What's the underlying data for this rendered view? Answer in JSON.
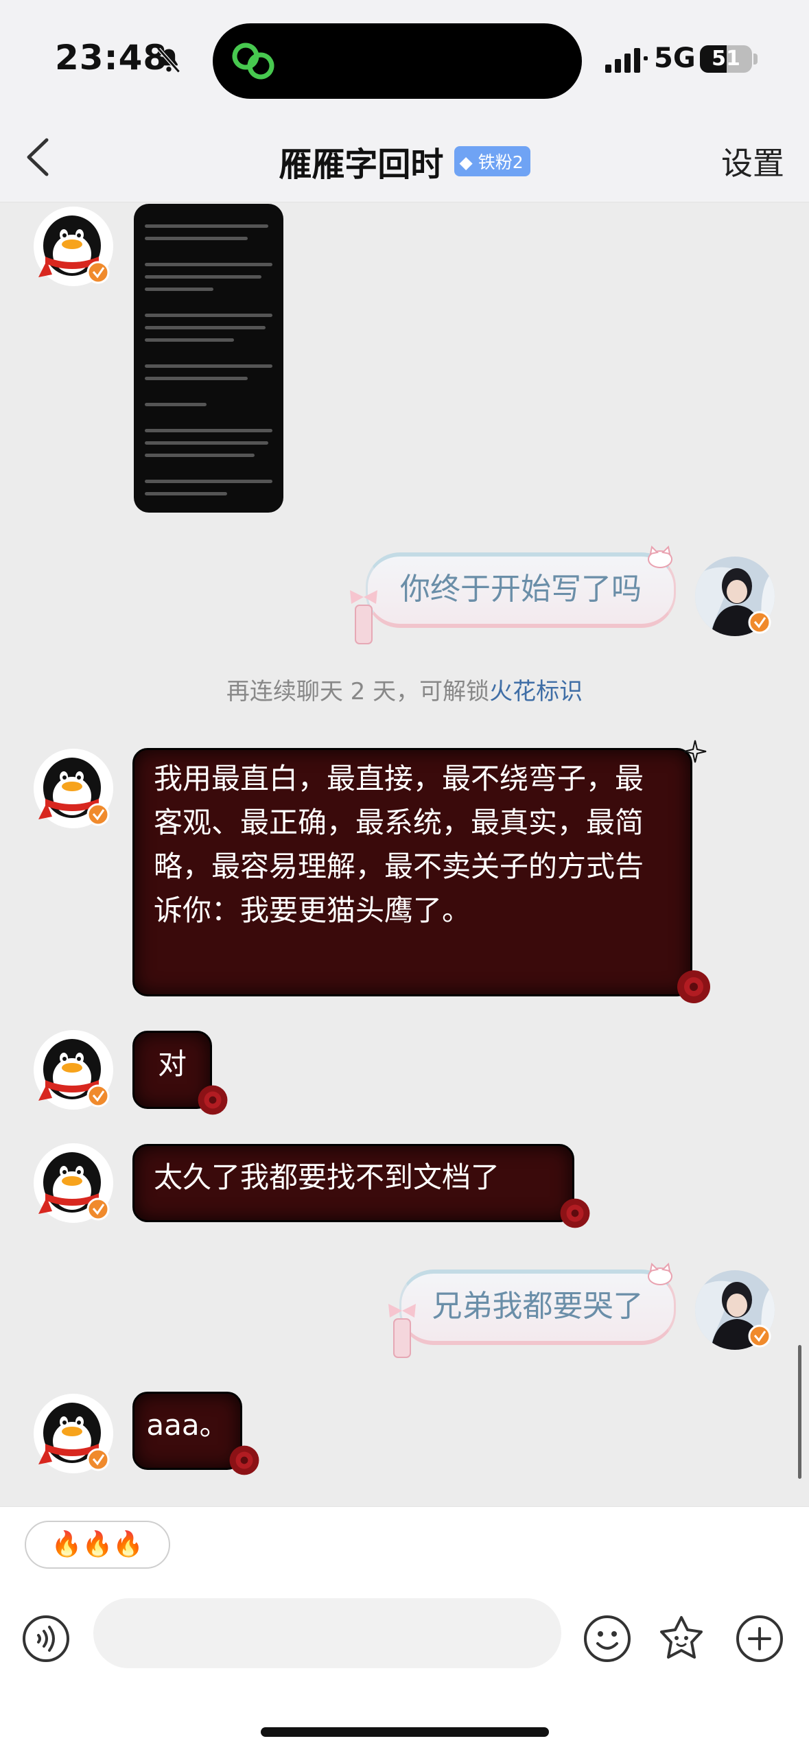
{
  "status_bar": {
    "time": "23:48",
    "network": "5G",
    "battery": "51",
    "battery_level": 0.51,
    "icons": [
      "bell-slash-icon",
      "app-link-icon",
      "signal-icon"
    ]
  },
  "header": {
    "back_icon": "chevron-left-icon",
    "title": "雁雁字回时",
    "badge": "铁粉2",
    "badge_icon": "diamond-icon",
    "settings": "设置"
  },
  "messages": [
    {
      "side": "left",
      "type": "image"
    },
    {
      "side": "right",
      "text": "你终于开始写了吗"
    },
    {
      "side": "system",
      "text": "再连续聊天 2 天，可解锁",
      "link": "火花标识"
    },
    {
      "side": "left",
      "text": "我用最直白，最直接，最不绕弯子，最客观、最正确，最系统，最真实，最简略，最容易理解，最不卖关子的方式告诉你：我要更猫头鹰了。"
    },
    {
      "side": "left",
      "text": "对"
    },
    {
      "side": "left",
      "text": "太久了我都要找不到文档了"
    },
    {
      "side": "right",
      "text": "兄弟我都要哭了"
    },
    {
      "side": "left",
      "text": "aaa。"
    }
  ],
  "quick_reply": {
    "text": "🔥🔥🔥"
  },
  "input_bar": {
    "placeholder": "",
    "icons": [
      "voice-icon",
      "emoji-icon",
      "sticker-icon",
      "plus-icon"
    ]
  },
  "colors": {
    "dark_bubble": "#3a0a0b",
    "light_bubble_text": "#6a8ea8",
    "link": "#3f6ea6",
    "badge": "#6fa3f4",
    "vip": "#f08a2c"
  }
}
